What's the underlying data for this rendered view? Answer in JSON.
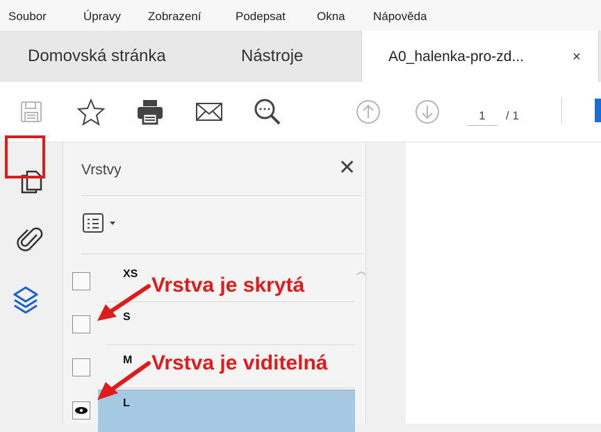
{
  "menu": {
    "items": [
      "Soubor",
      "Úpravy",
      "Zobrazení",
      "Podepsat",
      "Okna",
      "Nápověda"
    ]
  },
  "tabs": {
    "home": "Domovská stránka",
    "tools": "Nástroje",
    "document": "A0_halenka-pro-zd...",
    "close": "×"
  },
  "toolbar": {
    "icons": [
      "save-icon",
      "star-icon",
      "print-icon",
      "email-icon",
      "search-icon",
      "arrow-up-icon",
      "arrow-down-icon"
    ],
    "page_number": "1",
    "page_total": "/ 1"
  },
  "sidebar": {
    "icons": [
      "pages-icon",
      "paperclip-icon",
      "layers-icon"
    ],
    "active": "layers-icon"
  },
  "layers_panel": {
    "title": "Vrstvy",
    "close": "✕",
    "layers": [
      {
        "name": "XS",
        "visible": false
      },
      {
        "name": "S",
        "visible": false
      },
      {
        "name": "M",
        "visible": false
      },
      {
        "name": "L",
        "visible": true,
        "selected": true
      }
    ]
  },
  "annotations": {
    "hidden_label": "Vrstva je skrytá",
    "visible_label": "Vrstva je viditelná"
  },
  "colors": {
    "annotation_red": "#e01b1b",
    "selection_blue": "#a6c9e3",
    "icon_blue": "#1a5fd1"
  }
}
